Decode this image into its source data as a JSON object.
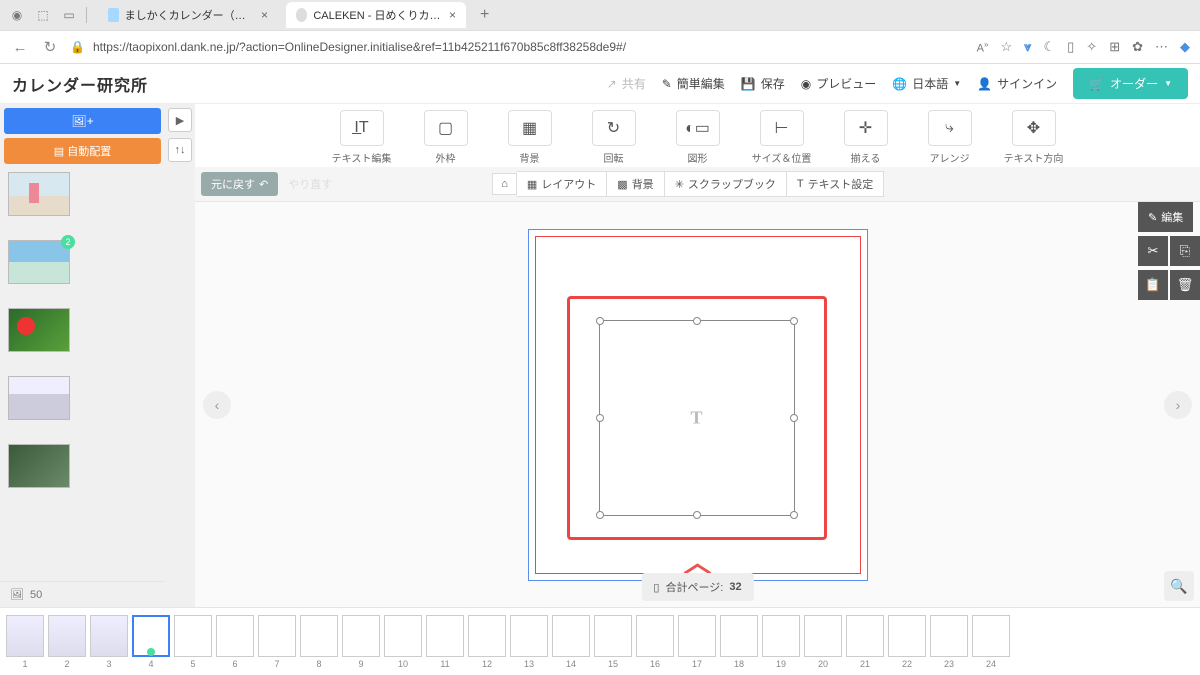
{
  "browser": {
    "tabs": [
      {
        "label": "ましかくカレンダー（日めくり） - "
      },
      {
        "label": "CALEKEN - 日めくりカレンダー"
      }
    ],
    "new_tab": "+",
    "url": "https://taopixonl.dank.ne.jp/?action=OnlineDesigner.initialise&ref=11b425211f670b85c8ff38258de9#/",
    "aa_icon": "A",
    "star": "☆"
  },
  "header": {
    "logo": "カレンダー研究所",
    "share": "共有",
    "simple_edit": "簡単編集",
    "save": "保存",
    "preview": "プレビュー",
    "language": "日本語",
    "signin": "サインイン",
    "order": "オーダー"
  },
  "left_buttons": {
    "add_images_icon": "🖼+",
    "auto_layout": "自動配置"
  },
  "thumbs": {
    "badge2": "2",
    "footer_count": "50"
  },
  "toolbar": {
    "text_edit": "テキスト編集",
    "frame": "外枠",
    "background": "背景",
    "rotate": "回転",
    "shape": "図形",
    "size_pos": "サイズ＆位置",
    "swap": "揃える",
    "arrange": "アレンジ",
    "text_dir": "テキスト方向"
  },
  "tabbar": {
    "undo": "元に戻す",
    "redo": "やり直す",
    "layout": "レイアウト",
    "background": "背景",
    "scrapbook": "スクラップブック",
    "text_settings": "テキスト設定"
  },
  "canvas": {
    "placeholder": "T",
    "page_total_label": "合計ページ:",
    "page_total_value": "32"
  },
  "right_rail": {
    "edit": "編集"
  },
  "footer": {
    "pages": [
      "1",
      "2",
      "3",
      "4",
      "5",
      "6",
      "7",
      "8",
      "9",
      "10",
      "11",
      "12",
      "13",
      "14",
      "15",
      "16",
      "17",
      "18",
      "19",
      "20",
      "21",
      "22",
      "23",
      "24"
    ],
    "selected_index": 3
  }
}
